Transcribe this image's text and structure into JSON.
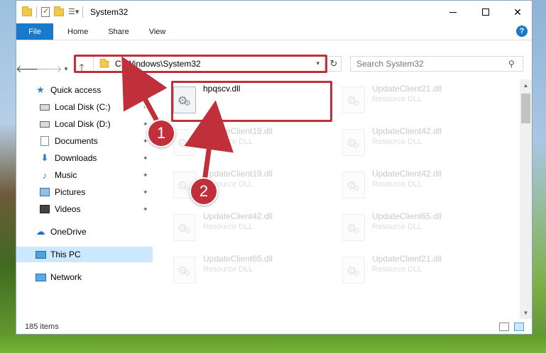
{
  "window": {
    "title": "System32",
    "minimize_icon": "minimize-icon",
    "maximize_icon": "maximize-icon",
    "close_glyph": "✕"
  },
  "ribbon": {
    "tabs": [
      {
        "label": "File"
      },
      {
        "label": "Home"
      },
      {
        "label": "Share"
      },
      {
        "label": "View"
      }
    ],
    "help_glyph": "?"
  },
  "address": {
    "path": "C:\\Windows\\System32",
    "search_placeholder": "Search System32"
  },
  "navpane": {
    "items": [
      {
        "label": "Quick access",
        "icon": "star-icon"
      },
      {
        "label": "Local Disk (C:)",
        "icon": "disk-icon"
      },
      {
        "label": "Local Disk (D:)",
        "icon": "disk-icon"
      },
      {
        "label": "Documents",
        "icon": "documents-icon"
      },
      {
        "label": "Downloads",
        "icon": "download-icon"
      },
      {
        "label": "Music",
        "icon": "music-icon"
      },
      {
        "label": "Pictures",
        "icon": "pictures-icon"
      },
      {
        "label": "Videos",
        "icon": "videos-icon"
      },
      {
        "label": "OneDrive",
        "icon": "cloud-icon"
      },
      {
        "label": "This PC",
        "icon": "computer-icon"
      },
      {
        "label": "Network",
        "icon": "network-icon"
      }
    ]
  },
  "files": [
    {
      "name": "hpqscv.dll",
      "type": ""
    },
    {
      "name": "UpdateClient21.dll",
      "type": "Resource DLL"
    },
    {
      "name": "UpdateClient19.dll",
      "type": "Resource DLL"
    },
    {
      "name": "UpdateClient42.dll",
      "type": "Resource DLL"
    },
    {
      "name": "UpdateClient19.dll",
      "type": "Resource DLL"
    },
    {
      "name": "UpdateClient42.dll",
      "type": "Resource DLL"
    },
    {
      "name": "UpdateClient42.dll",
      "type": "Resource DLL"
    },
    {
      "name": "UpdateClient65.dll",
      "type": "Resource DLL"
    },
    {
      "name": "UpdateClient65.dll",
      "type": "Resource DLL"
    },
    {
      "name": "UpdateClient21.dll",
      "type": "Resource DLL"
    }
  ],
  "status": {
    "item_count": "185 items"
  },
  "callouts": {
    "one": "1",
    "two": "2"
  },
  "colors": {
    "accent": "#1979ca",
    "callout": "#c0303a",
    "selection": "#cce8ff"
  }
}
